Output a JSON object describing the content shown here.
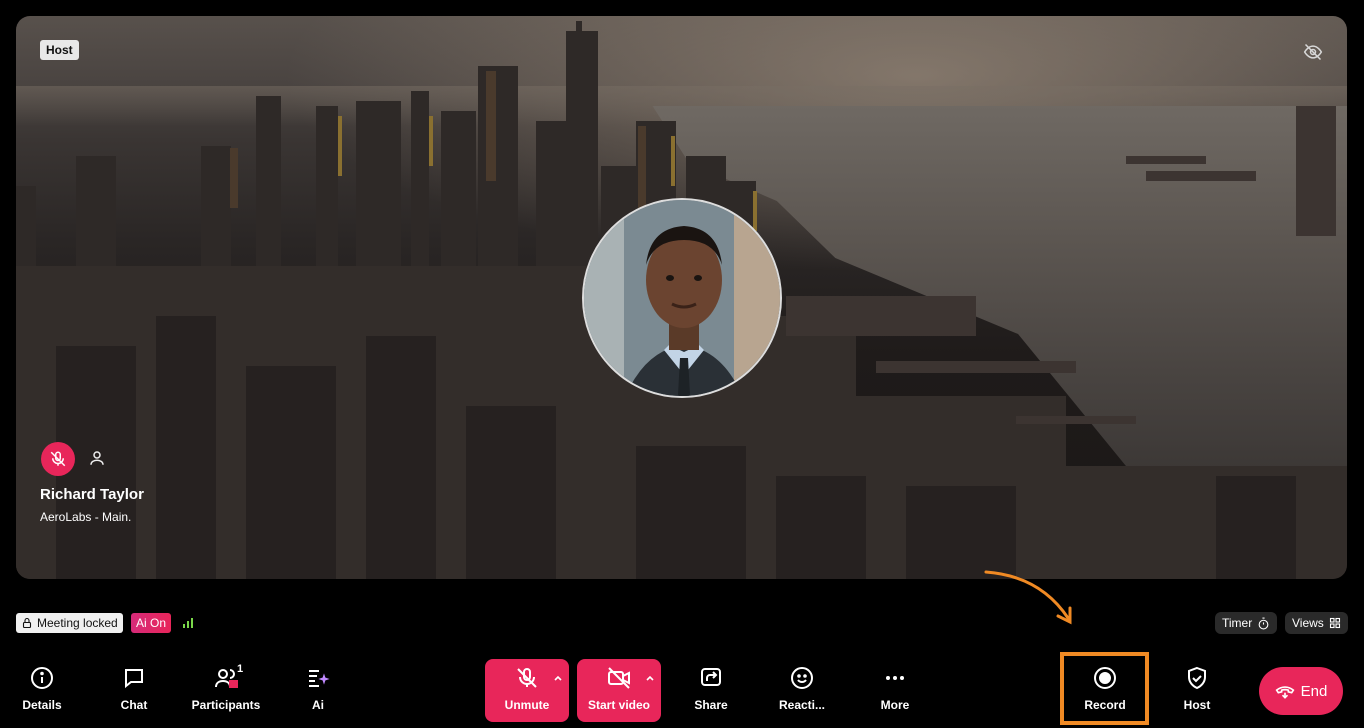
{
  "video": {
    "host_badge": "Host",
    "participant_name": "Richard Taylor",
    "participant_subtitle": "AeroLabs - Main."
  },
  "status": {
    "lock_label": "Meeting locked",
    "ai_label": "Ai On",
    "timer_label": "Timer",
    "views_label": "Views"
  },
  "toolbar": {
    "details": "Details",
    "chat": "Chat",
    "participants": "Participants",
    "participants_count": "1",
    "ai": "Ai",
    "unmute": "Unmute",
    "start_video": "Start video",
    "share": "Share",
    "reactions": "Reacti...",
    "more": "More",
    "record": "Record",
    "host": "Host",
    "end": "End"
  },
  "colors": {
    "accent": "#e8265a",
    "highlight_box": "#f08a24"
  }
}
